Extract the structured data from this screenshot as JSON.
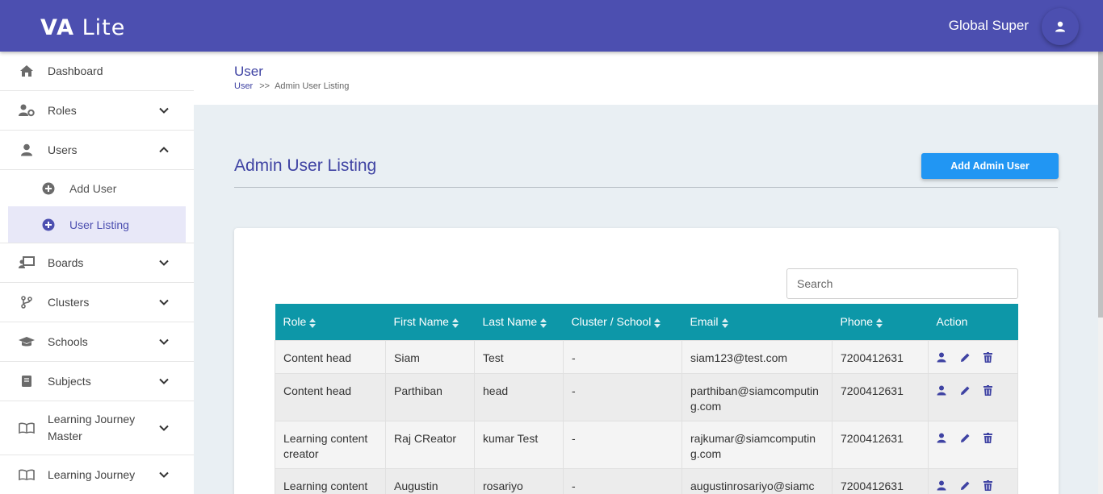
{
  "app": {
    "brand_bold": "VA",
    "brand_light": "Lite"
  },
  "header": {
    "user_name": "Global Super"
  },
  "sidebar": {
    "items": [
      {
        "label": "Dashboard"
      },
      {
        "label": "Roles"
      },
      {
        "label": "Users"
      },
      {
        "label": "Boards"
      },
      {
        "label": "Clusters"
      },
      {
        "label": "Schools"
      },
      {
        "label": "Subjects"
      },
      {
        "label": "Learning Journey Master"
      },
      {
        "label": "Learning Journey"
      }
    ],
    "users_sub": [
      {
        "label": "Add User"
      },
      {
        "label": "User Listing"
      }
    ]
  },
  "page": {
    "title": "User",
    "breadcrumb": [
      "User",
      ">>",
      "Admin User Listing"
    ]
  },
  "listing": {
    "title": "Admin User Listing",
    "add_button": "Add Admin User",
    "search_placeholder": "Search",
    "columns": [
      "Role",
      "First Name",
      "Last Name",
      "Cluster / School",
      "Email",
      "Phone",
      "Action"
    ],
    "rows": [
      [
        "Content head",
        "Siam",
        "Test",
        "-",
        "siam123@test.com",
        "7200412631"
      ],
      [
        "Content head",
        "Parthiban",
        "head",
        "-",
        "parthiban@siamcomputing.com",
        "7200412631"
      ],
      [
        "Learning content creator",
        "Raj CReator",
        "kumar Test",
        "-",
        "rajkumar@siamcomputing.com",
        "7200412631"
      ],
      [
        "Learning content",
        "Augustin",
        "rosariyo",
        "-",
        "augustinrosariyo@siamc",
        "7200412631"
      ]
    ]
  },
  "colors": {
    "topbar": "#4c4fb0",
    "table_header": "#0d97a8",
    "primary_button": "#2196f3",
    "accent_text": "#3f43a3"
  }
}
